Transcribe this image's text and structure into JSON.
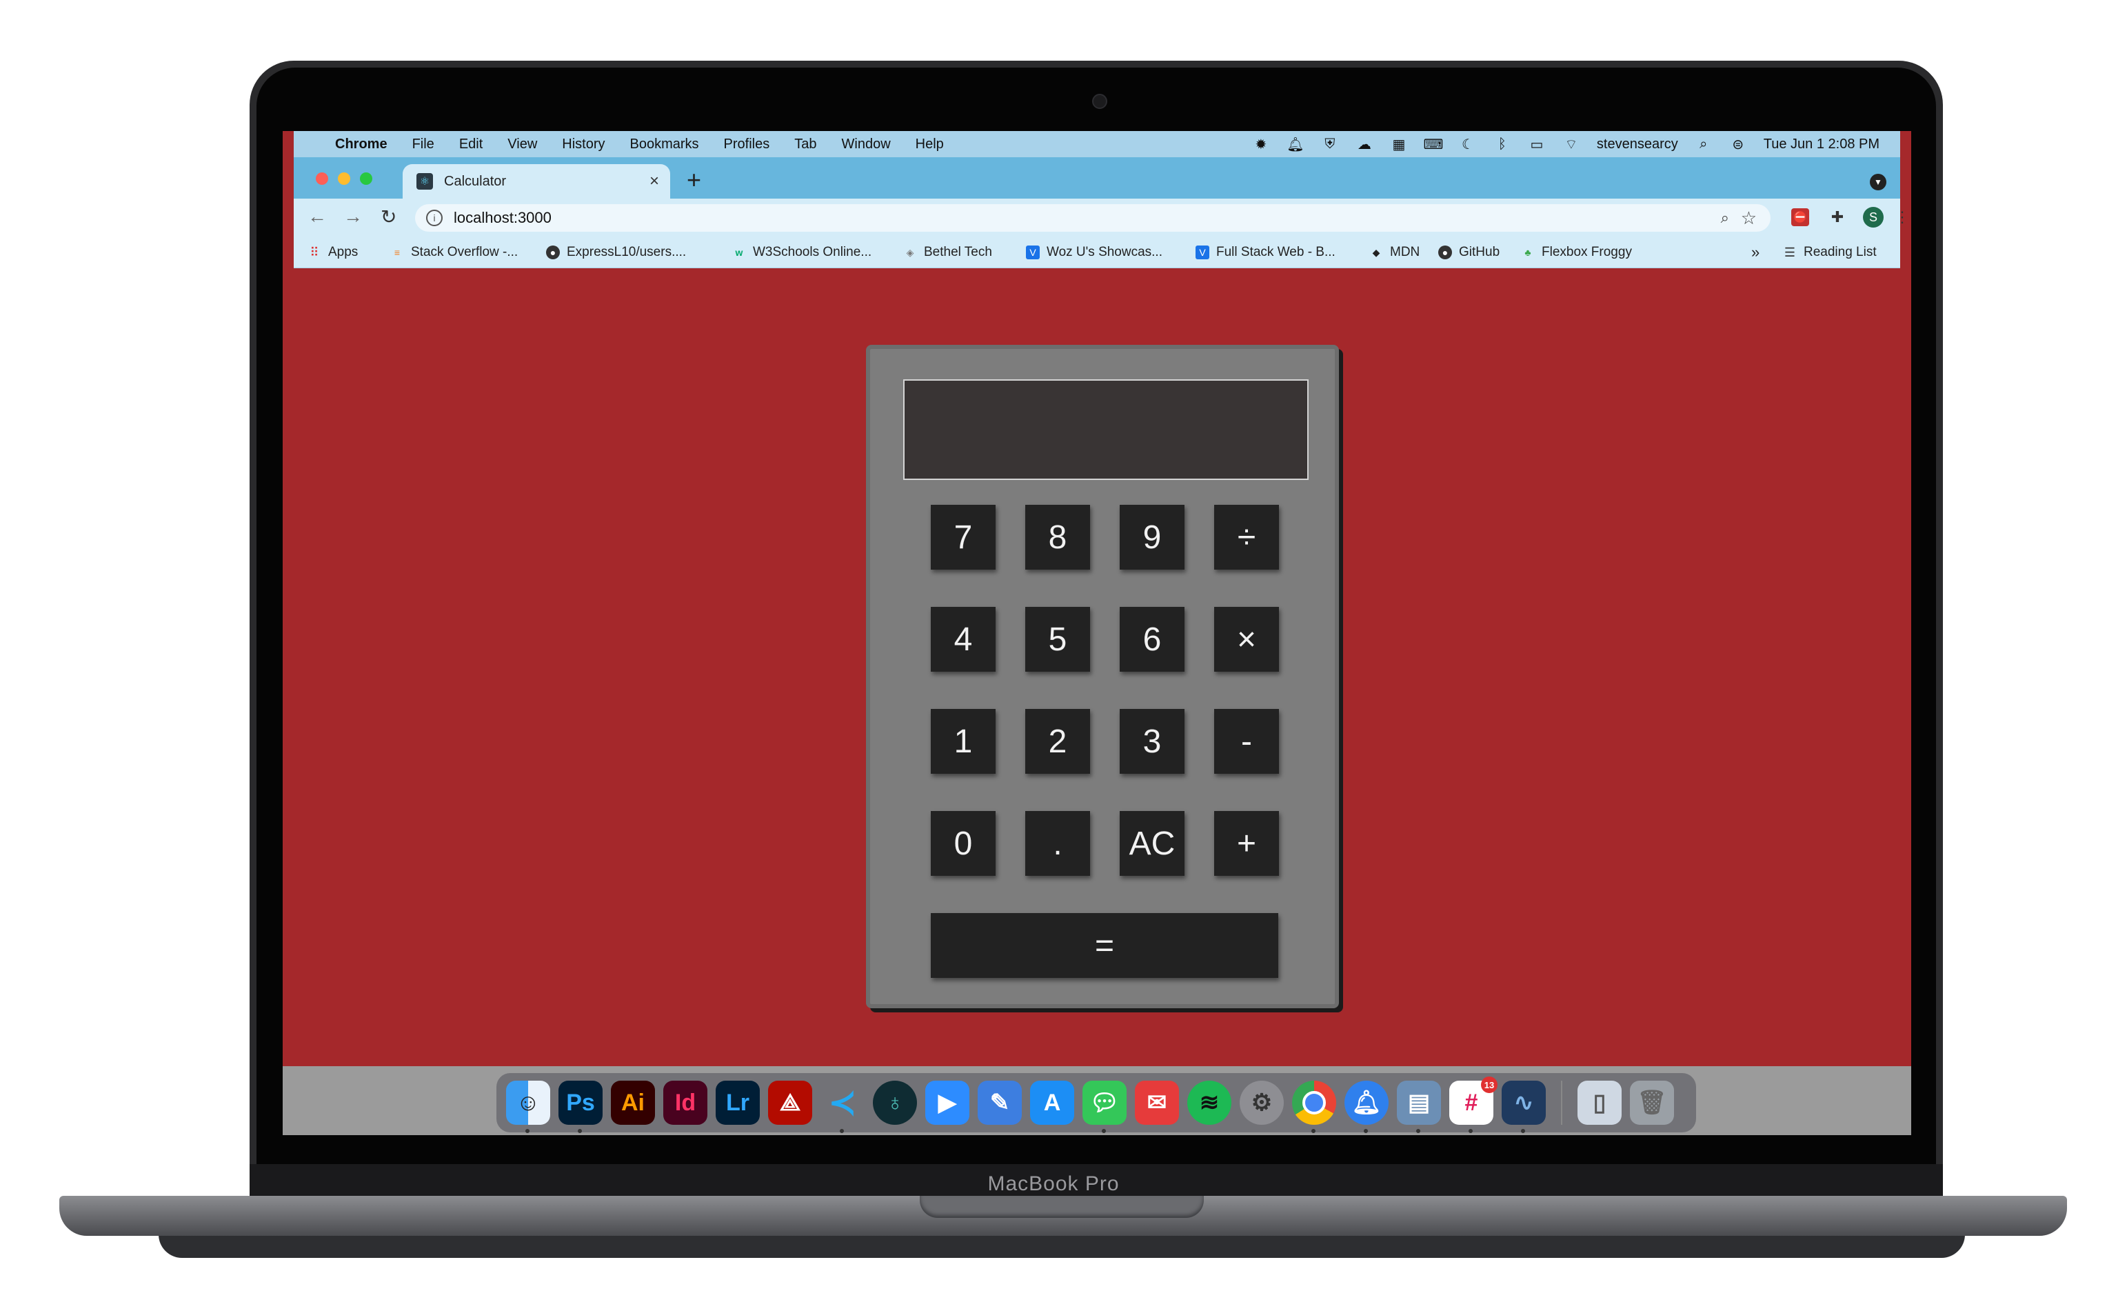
{
  "device": {
    "brand_label": "MacBook Pro"
  },
  "menubar": {
    "app": "Chrome",
    "items": [
      "File",
      "Edit",
      "View",
      "History",
      "Bookmarks",
      "Profiles",
      "Tab",
      "Window",
      "Help"
    ],
    "user": "stevensearcy",
    "datetime": "Tue Jun 1  2:08 PM"
  },
  "browser": {
    "tab_title": "Calculator",
    "url_host": "localhost",
    "url_port": ":3000",
    "url": "localhost:3000",
    "profile_initial": "S",
    "bookmarks": [
      {
        "label": "Apps",
        "icon": "apps-grid-icon"
      },
      {
        "label": "Stack Overflow -...",
        "icon": "stackoverflow-icon"
      },
      {
        "label": "ExpressL10/users....",
        "icon": "github-icon"
      },
      {
        "label": "W3Schools Online...",
        "icon": "w3schools-icon"
      },
      {
        "label": "Bethel Tech",
        "icon": "bethel-icon"
      },
      {
        "label": "Woz U's Showcas...",
        "icon": "wozu-icon"
      },
      {
        "label": "Full Stack Web - B...",
        "icon": "wozu-icon"
      },
      {
        "label": "MDN",
        "icon": "mdn-icon"
      },
      {
        "label": "GitHub",
        "icon": "github-icon"
      },
      {
        "label": "Flexbox Froggy",
        "icon": "frog-icon"
      }
    ],
    "overflow": "»",
    "reading_list": "Reading List"
  },
  "calculator": {
    "display_value": "",
    "keys": {
      "k7": "7",
      "k8": "8",
      "k9": "9",
      "divide": "÷",
      "k4": "4",
      "k5": "5",
      "k6": "6",
      "multiply": "×",
      "k1": "1",
      "k2": "2",
      "k3": "3",
      "subtract": "-",
      "k0": "0",
      "decimal": ".",
      "clear": "AC",
      "add": "+",
      "equals": "="
    }
  },
  "dock": {
    "ps": "Ps",
    "ai": "Ai",
    "id": "Id",
    "lr": "Lr",
    "slack_badge": "13"
  },
  "colors": {
    "page_background": "#a5282b",
    "calculator_body": "#7d7d7d",
    "key_background": "#222222",
    "display_background": "#393434"
  }
}
